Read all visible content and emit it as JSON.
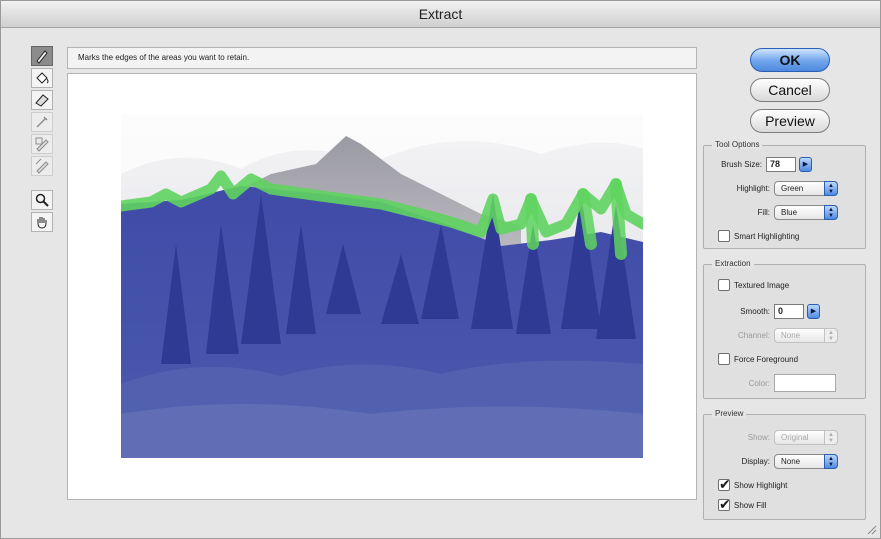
{
  "window": {
    "title": "Extract"
  },
  "hint": {
    "text": "Marks the edges of the areas you want to retain."
  },
  "icons": {
    "tools": [
      "edge-highlighter-icon",
      "fill-bucket-icon",
      "eraser-icon",
      "eyedropper-icon",
      "cleanup-tool-icon",
      "edge-touchup-icon",
      "zoom-icon",
      "hand-icon"
    ]
  },
  "buttons": {
    "ok": "OK",
    "cancel": "Cancel",
    "preview": "Preview"
  },
  "tool_options": {
    "title": "Tool Options",
    "brush_size_label": "Brush Size:",
    "brush_size_value": "78",
    "highlight_label": "Highlight:",
    "highlight_value": "Green",
    "fill_label": "Fill:",
    "fill_value": "Blue",
    "smart_highlighting_label": "Smart Highlighting",
    "smart_highlighting_checked": false
  },
  "extraction": {
    "title": "Extraction",
    "textured_image_label": "Textured Image",
    "textured_image_checked": false,
    "smooth_label": "Smooth:",
    "smooth_value": "0",
    "channel_label": "Channel:",
    "channel_value": "None",
    "force_foreground_label": "Force Foreground",
    "force_foreground_checked": false,
    "color_label": "Color:"
  },
  "preview": {
    "title": "Preview",
    "show_label": "Show:",
    "show_value": "Original",
    "display_label": "Display:",
    "display_value": "None",
    "show_highlight_label": "Show Highlight",
    "show_highlight_checked": true,
    "show_fill_label": "Show Fill",
    "show_fill_checked": true
  },
  "colors": {
    "highlight": "#5fd35f",
    "fill": "#3a48a8",
    "accent": "#4f8ae0"
  }
}
